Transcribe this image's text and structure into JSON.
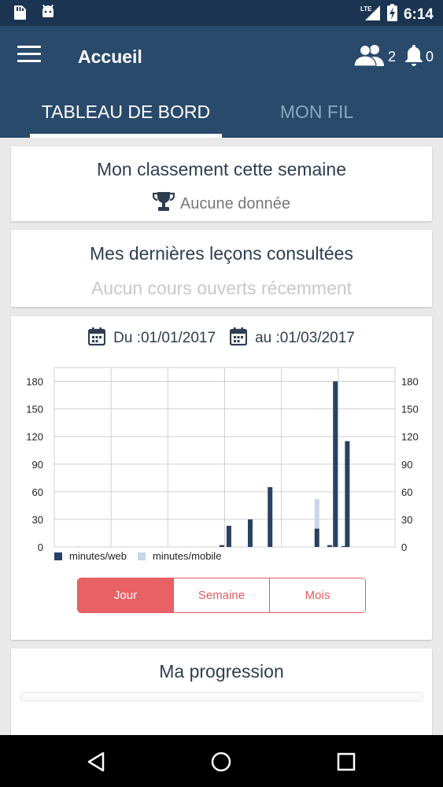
{
  "status_bar": {
    "network": "LTE",
    "time": "6:14"
  },
  "app_bar": {
    "title": "Accueil",
    "users_count": "2",
    "notifications_count": "0"
  },
  "tabs": [
    {
      "label": "TABLEAU DE BORD",
      "active": true
    },
    {
      "label": "MON FIL",
      "active": false
    }
  ],
  "ranking_card": {
    "title": "Mon classement cette semaine",
    "message": "Aucune donnée"
  },
  "lessons_card": {
    "title": "Mes dernières leçons consultées",
    "message": "Aucun cours ouverts récemment"
  },
  "activity_card": {
    "date_from": "Du :01/01/2017",
    "date_to": "au :01/03/2017",
    "period_buttons": [
      {
        "label": "Jour",
        "selected": true
      },
      {
        "label": "Semaine",
        "selected": false
      },
      {
        "label": "Mois",
        "selected": false
      }
    ]
  },
  "chart_data": {
    "type": "bar",
    "stacked": true,
    "ylim": [
      0,
      195
    ],
    "yticks": [
      0,
      30,
      60,
      90,
      120,
      150,
      180
    ],
    "y_axis_right_mirror": true,
    "grid": true,
    "legend_position": "bottom-left",
    "x_category_count": 12,
    "series": [
      {
        "name": "minutes/web",
        "color": "#2a4064",
        "values": [
          0,
          0,
          0,
          0,
          2,
          23,
          30,
          65,
          0,
          20,
          2,
          180,
          1,
          115
        ]
      },
      {
        "name": "minutes/mobile",
        "color": "#c5d5ea",
        "values": [
          0,
          0,
          0,
          0,
          0,
          0,
          0,
          0,
          0,
          32,
          0,
          0,
          0,
          0
        ]
      }
    ],
    "bar_slots": [
      0,
      1,
      2,
      3,
      5.4,
      5.65,
      6.4,
      7.1,
      8,
      8.75,
      9.2,
      9.4,
      9.7,
      9.82
    ]
  },
  "progress_card": {
    "title": "Ma progression",
    "progress_fraction": 0
  }
}
